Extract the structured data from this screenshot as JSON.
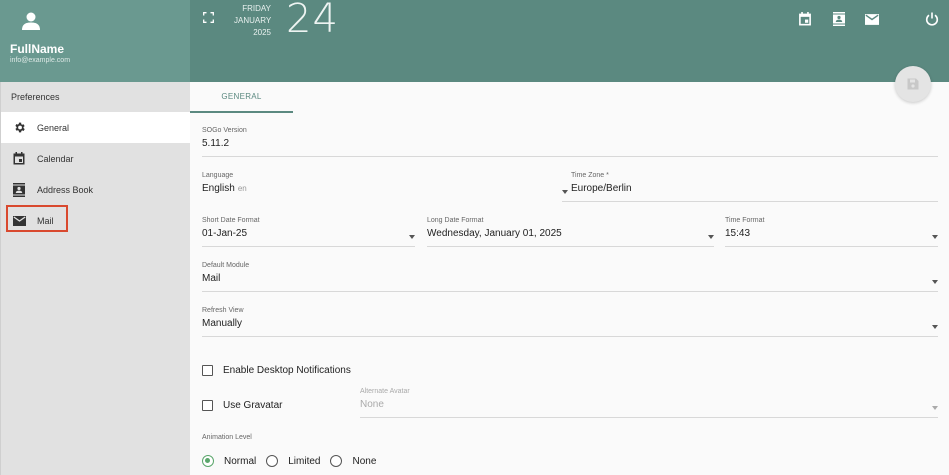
{
  "profile": {
    "name": "FullName",
    "email": "info@example.com"
  },
  "header": {
    "weekday": "FRIDAY",
    "month": "JANUARY",
    "year": "2025",
    "day": "24"
  },
  "sidebar": {
    "title": "Preferences",
    "items": [
      {
        "label": "General",
        "icon": "gear-icon",
        "active": true
      },
      {
        "label": "Calendar",
        "icon": "calendar-icon",
        "active": false
      },
      {
        "label": "Address Book",
        "icon": "contacts-icon",
        "active": false
      },
      {
        "label": "Mail",
        "icon": "mail-icon",
        "active": false
      }
    ]
  },
  "tabs": [
    {
      "label": "GENERAL",
      "active": true
    }
  ],
  "form": {
    "sogo_version": {
      "label": "SOGo Version",
      "value": "5.11.2"
    },
    "language": {
      "label": "Language",
      "value": "English",
      "code": "en"
    },
    "time_zone": {
      "label": "Time Zone *",
      "value": "Europe/Berlin"
    },
    "short_date": {
      "label": "Short Date Format",
      "value": "01-Jan-25"
    },
    "long_date": {
      "label": "Long Date Format",
      "value": "Wednesday, January 01, 2025"
    },
    "time_format": {
      "label": "Time Format",
      "value": "15:43"
    },
    "default_module": {
      "label": "Default Module",
      "value": "Mail"
    },
    "refresh_view": {
      "label": "Refresh View",
      "value": "Manually"
    },
    "desktop_notifications": {
      "label": "Enable Desktop Notifications",
      "checked": false
    },
    "gravatar": {
      "label": "Use Gravatar",
      "checked": false
    },
    "alternate_avatar": {
      "label": "Alternate Avatar",
      "value": "None"
    },
    "animation": {
      "label": "Animation Level",
      "options": [
        "Normal",
        "Limited",
        "None"
      ],
      "selected": "Normal"
    }
  },
  "colors": {
    "header": "#5b8980",
    "profile": "#6a9990",
    "accent": "#5b8980",
    "radio": "#5aa66b",
    "highlight": "#d9492f"
  }
}
